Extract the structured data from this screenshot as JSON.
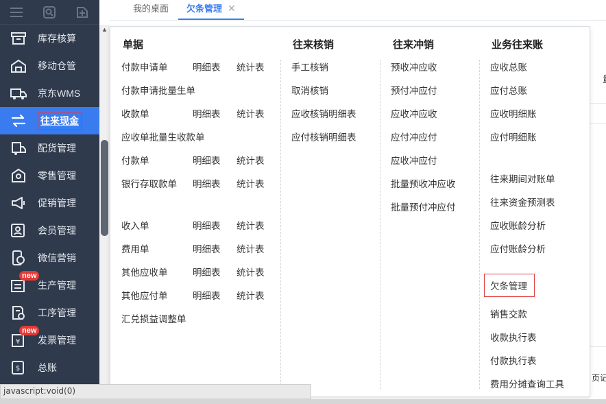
{
  "tabs": [
    {
      "label": "我的桌面",
      "active": false
    },
    {
      "label": "欠条管理",
      "active": true,
      "close": "✕"
    }
  ],
  "sidebar": {
    "top_icons": [
      "menu-icon",
      "search-doc-icon",
      "add-doc-icon"
    ],
    "items": [
      {
        "label": "库存核算",
        "icon": "inventory-icon"
      },
      {
        "label": "移动仓管",
        "icon": "mobile-warehouse-icon"
      },
      {
        "label": "京东WMS",
        "icon": "truck-icon"
      },
      {
        "label": "往来现金",
        "icon": "exchange-icon",
        "active": true
      },
      {
        "label": "配货管理",
        "icon": "delivery-icon"
      },
      {
        "label": "零售管理",
        "icon": "retail-icon"
      },
      {
        "label": "促销管理",
        "icon": "megaphone-icon"
      },
      {
        "label": "会员管理",
        "icon": "member-icon"
      },
      {
        "label": "微信营销",
        "icon": "wechat-icon"
      },
      {
        "label": "生产管理",
        "icon": "production-icon",
        "badge": "new"
      },
      {
        "label": "工序管理",
        "icon": "process-icon"
      },
      {
        "label": "发票管理",
        "icon": "invoice-icon",
        "badge": "new"
      },
      {
        "label": "总账",
        "icon": "ledger-icon"
      }
    ]
  },
  "menu": {
    "documents": {
      "header": "单据",
      "rows": [
        {
          "label": "付款申请单",
          "detail": "明细表",
          "stats": "统计表"
        },
        {
          "label": "付款申请批量生单"
        },
        {
          "label": "收款单",
          "detail": "明细表",
          "stats": "统计表"
        },
        {
          "label": "应收单批量生收款单"
        },
        {
          "label": "付款单",
          "detail": "明细表",
          "stats": "统计表"
        },
        {
          "label": "银行存取款单",
          "detail": "明细表",
          "stats": "统计表"
        },
        {
          "label": "收入单",
          "detail": "明细表",
          "stats": "统计表"
        },
        {
          "label": "费用单",
          "detail": "明细表",
          "stats": "统计表"
        },
        {
          "label": "其他应收单",
          "detail": "明细表",
          "stats": "统计表"
        },
        {
          "label": "其他应付单",
          "detail": "明细表",
          "stats": "统计表"
        },
        {
          "label": "汇兑损益调整单"
        }
      ]
    },
    "verification": {
      "header": "往来核销",
      "items": [
        "手工核销",
        "取消核销",
        "应收核销明细表",
        "应付核销明细表"
      ]
    },
    "offset": {
      "header": "往来冲销",
      "items": [
        "预收冲应收",
        "预付冲应付",
        "应收冲应收",
        "应付冲应付",
        "应收冲应付",
        "批量预收冲应收",
        "批量预付冲应付"
      ]
    },
    "ledger": {
      "header": "业务往来账",
      "items": [
        "应收总账",
        "应付总账",
        "应收明细账",
        "应付明细账",
        "往来期间对账单",
        "往来资金预测表",
        "应收账龄分析",
        "应付账龄分析",
        "欠条管理",
        "销售交款",
        "收款执行表",
        "付款执行表",
        "费用分摊查询工具"
      ]
    }
  },
  "right_fragment": {
    "top_char": "量",
    "bottom_text": "页记"
  },
  "status": "javascript:void(0)"
}
